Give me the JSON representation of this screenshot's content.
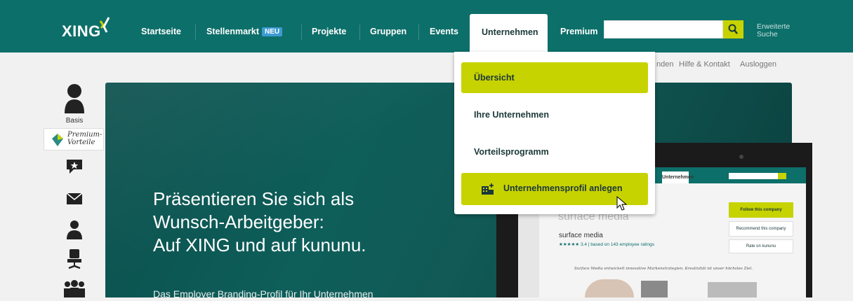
{
  "header": {
    "logo_text": "XING",
    "nav": {
      "startseite": "Startseite",
      "stellenmarkt": "Stellenmarkt",
      "stellenmarkt_badge": "NEU",
      "projekte": "Projekte",
      "gruppen": "Gruppen",
      "events": "Events",
      "unternehmen": "Unternehmen",
      "premium": "Premium"
    },
    "search": {
      "value": "",
      "placeholder": ""
    },
    "advanced_search_line1": "Erweiterte",
    "advanced_search_line2": "Suche"
  },
  "subbar": {
    "partial_link": "nden",
    "help_contact": "Hilfe & Kontakt",
    "logout": "Ausloggen"
  },
  "dropdown": {
    "items": [
      {
        "label": "Übersicht"
      },
      {
        "label": "Ihre Unternehmen"
      },
      {
        "label": "Vorteilsprogramm"
      },
      {
        "label": "Unternehmensprofil anlegen"
      }
    ]
  },
  "sidebar": {
    "basis": "Basis",
    "premium_line1": "Premium-",
    "premium_line2": "Vorteile"
  },
  "hero": {
    "title_line1": "Präsentieren Sie sich als",
    "title_line2": "Wunsch-Arbeitgeber:",
    "title_line3": "Auf XING und auf kununu.",
    "subtitle": "Das Employer Branding-Profil für Ihr Unternehmen"
  },
  "screen_mock": {
    "tab": "Unternehmen",
    "company_partial": "surface media",
    "company_name": "surface media",
    "rating": "★★★★★ 3.4 | based on 143 employee ratings",
    "follow": "Follow this company",
    "recommend": "Recommend this company",
    "rate": "Rate on kununu",
    "quote": "Surface Media entwickelt innovative Markenstrategien. Kreativität ist unser höchstes Ziel."
  },
  "colors": {
    "brand": "#0d6f6a",
    "accent": "#c7d300",
    "badge": "#3d9bd3"
  }
}
